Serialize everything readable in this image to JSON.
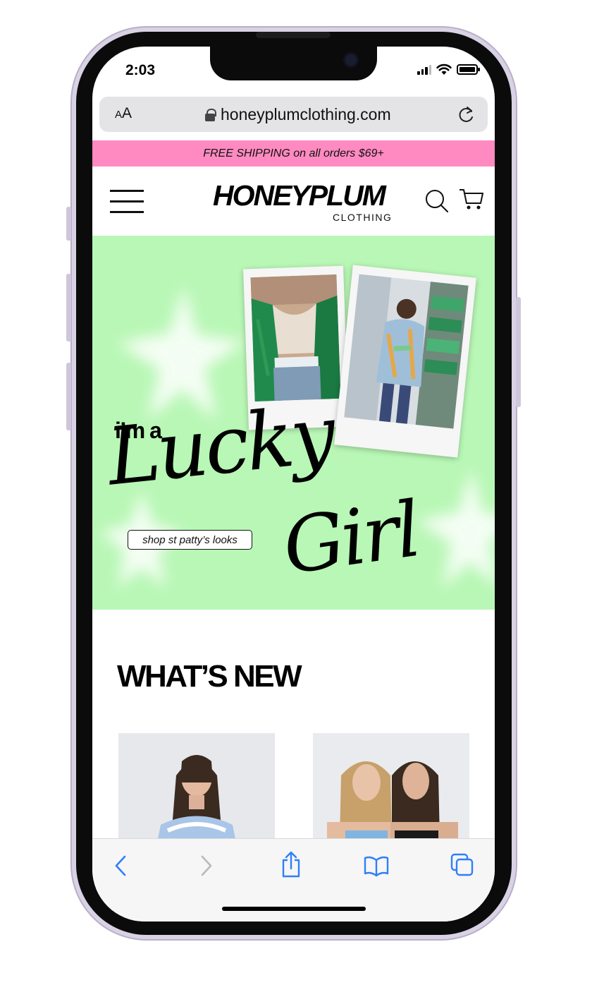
{
  "status_bar": {
    "time": "2:03"
  },
  "browser": {
    "text_size_button": "AA",
    "url": "honeyplumclothing.com"
  },
  "promo": {
    "text": "FREE SHIPPING on all orders $69+"
  },
  "header": {
    "logo_main": "HONEYPLUM",
    "logo_sub": "CLOTHING",
    "icons": [
      "menu-icon",
      "search-icon",
      "cart-icon"
    ]
  },
  "hero": {
    "line1": "i’m a",
    "line2": "Lucky",
    "line3": "Girl",
    "cta": "shop st patty’s looks",
    "background_color": "#b8f7b5"
  },
  "whats_new": {
    "title": "WHAT’S NEW"
  },
  "toolbar": {
    "icons": [
      "back-icon",
      "forward-icon",
      "share-icon",
      "bookmarks-icon",
      "tabs-icon"
    ],
    "accent_color": "#2f7ff7"
  },
  "colors": {
    "promo_bg": "#ff8ac2",
    "hero_bg": "#b8f7b5",
    "phone_frame": "#d9d2e4"
  }
}
